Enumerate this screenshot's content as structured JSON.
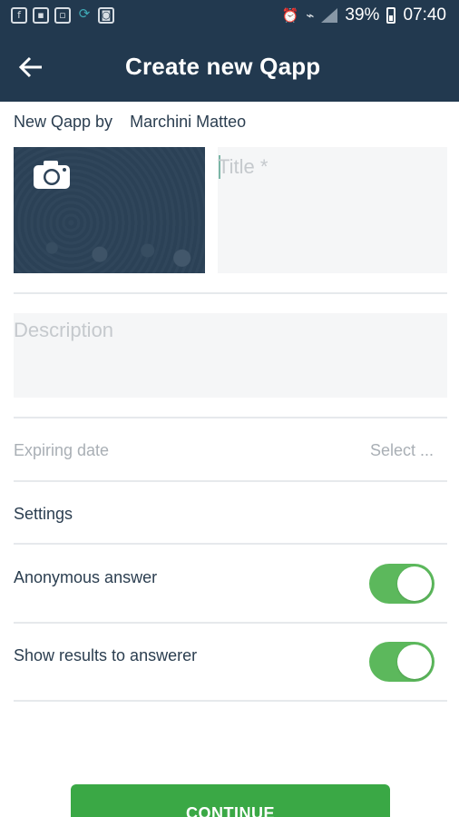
{
  "status_bar": {
    "battery": "39%",
    "time": "07:40",
    "left_icons": [
      "facebook-icon",
      "gallery-icon",
      "photo-icon",
      "sync-icon",
      "app-icon"
    ],
    "right_icons": [
      "alarm-icon",
      "wifi-icon",
      "signal-icon",
      "battery-icon"
    ]
  },
  "app_bar": {
    "title": "Create new Qapp",
    "back_icon": "back-arrow-icon",
    "color": "#22394f"
  },
  "byline": {
    "prefix": "New Qapp by",
    "author": "Marchini Matteo"
  },
  "photo": {
    "icon": "camera-icon"
  },
  "title_field": {
    "value": "",
    "placeholder": "Title *"
  },
  "description_field": {
    "value": "",
    "placeholder": "Description"
  },
  "expiring_date": {
    "label": "Expiring date",
    "value": "Select ..."
  },
  "settings": {
    "heading": "Settings",
    "options": [
      {
        "label": "Anonymous answer",
        "enabled": true
      },
      {
        "label": "Show results to answerer",
        "enabled": true
      }
    ]
  },
  "continue_label": "CONTINUE",
  "colors": {
    "accent_green": "#3aa845",
    "toggle_on": "#5cb85c"
  }
}
